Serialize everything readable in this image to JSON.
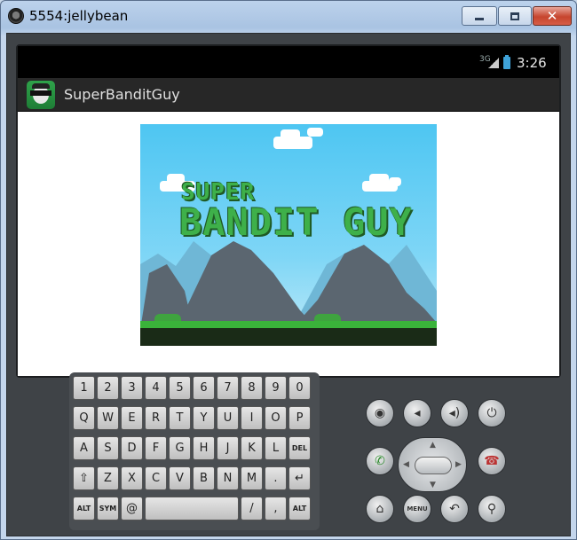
{
  "window": {
    "title": "5554:jellybean",
    "controls": {
      "minimize_icon": "minimize-icon",
      "maximize_icon": "maximize-icon",
      "close_icon": "close-icon"
    }
  },
  "statusbar": {
    "network": "3G",
    "time": "3:26"
  },
  "actionbar": {
    "app_title": "SuperBanditGuy"
  },
  "splash": {
    "title_line1": "SUPER",
    "title_line2": "BANDIT GUY"
  },
  "keyboard": {
    "row1": [
      {
        "main": "1",
        "alt": "!"
      },
      {
        "main": "2",
        "alt": "@"
      },
      {
        "main": "3",
        "alt": "#"
      },
      {
        "main": "4",
        "alt": "$"
      },
      {
        "main": "5",
        "alt": "%"
      },
      {
        "main": "6",
        "alt": "^"
      },
      {
        "main": "7",
        "alt": "&"
      },
      {
        "main": "8",
        "alt": "*"
      },
      {
        "main": "9",
        "alt": "("
      },
      {
        "main": "0",
        "alt": ")"
      }
    ],
    "row2": [
      "Q",
      "W",
      "E",
      "R",
      "T",
      "Y",
      "U",
      "I",
      "O",
      "P"
    ],
    "row3": [
      "A",
      "S",
      "D",
      "F",
      "G",
      "H",
      "J",
      "K",
      "L",
      "DEL"
    ],
    "row4": [
      "⇧",
      "Z",
      "X",
      "C",
      "V",
      "B",
      "N",
      "M",
      ".",
      "↵"
    ],
    "row5": [
      "ALT",
      "SYM",
      "@",
      "",
      "/",
      ",",
      "ALT"
    ]
  },
  "controls": {
    "camera": "camera-icon",
    "volume_down": "volume-down-icon",
    "volume_up": "volume-up-icon",
    "power": "power-icon",
    "call": "call-icon",
    "end_call": "end-call-icon",
    "home": "home-icon",
    "menu": "MENU",
    "back": "back-icon",
    "search": "search-icon"
  },
  "colors": {
    "sky": "#4ec6f2",
    "title_green": "#3eb04a",
    "grass": "#3ab33a",
    "emulator_body": "#3f4347"
  }
}
